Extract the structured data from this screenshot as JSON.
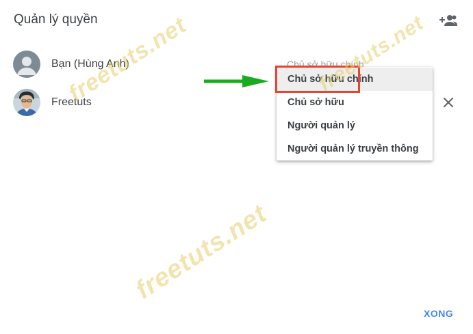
{
  "dialog": {
    "title": "Quản lý quyền",
    "add_people_icon": "add-people-icon",
    "done_label": "XONG"
  },
  "members": [
    {
      "name": "Bạn (Hùng Anh)",
      "role": "Chủ sở hữu chính",
      "avatar": "default-user-avatar"
    },
    {
      "name": "Freetuts",
      "avatar": "profile-photo-avatar",
      "remove_icon": "close-icon"
    }
  ],
  "role_menu": {
    "items": [
      "Chủ sở hữu chính",
      "Chủ sở hữu",
      "Người quản lý",
      "Người quản lý truyền thông"
    ],
    "selected_index": 0
  },
  "annotations": {
    "arrow_color": "#1aab1f",
    "highlight_color": "#e8432e"
  },
  "watermark": "freetuts.net",
  "colors": {
    "accent": "#4285f4",
    "menu_hover": "#eeeeee",
    "text": "#3c4043"
  }
}
